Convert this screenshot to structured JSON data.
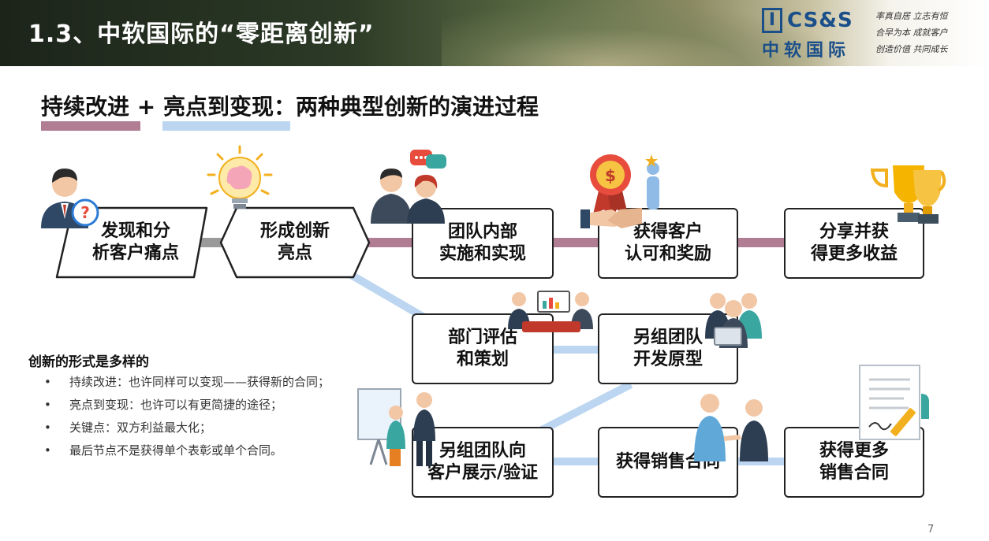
{
  "header": {
    "title": "1.3、中软国际的“零距离创新”"
  },
  "logo": {
    "mark": "I",
    "letters": "CS&S",
    "cn": "中软国际"
  },
  "motto": [
    "率真自居 立志有恒",
    "合早为本 成就客户",
    "创造价值 共同成长"
  ],
  "subtitle": {
    "prefix": "持续改进",
    "plus": "+",
    "highlight": "亮点到变现",
    "rest": "：两种典型创新的演进过程"
  },
  "colors": {
    "mauve": "#b07d93",
    "lightblue": "#bcd6f1",
    "gray": "#9a9a9a",
    "border": "#222222"
  },
  "nodes": {
    "discover": "发现和分\n析客户痛点",
    "form": "形成创新\n亮点",
    "team_impl": "团队内部\n实施和实现",
    "recognition": "获得客户\n认可和奖励",
    "share": "分享并获\n得更多收益",
    "dept_eval": "部门评估\n和策划",
    "proto": "另组团队\n开发原型",
    "demo": "另组团队向\n客户展示/验证",
    "contract": "获得销售合同",
    "more_contracts": "获得更多\n销售合同"
  },
  "forms": {
    "title": "创新的形式是多样的",
    "bullet": "•",
    "items": [
      "持续改进：也许同样可以变现——获得新的合同；",
      "亮点到变现：也许可以有更简捷的途径；",
      "关键点：双方利益最大化；",
      "最后节点不是获得单个表彰或单个合同。"
    ]
  },
  "icons": [
    "person-question-icon",
    "lightbulb-brain-icon",
    "team-discussion-icon",
    "award-medal-icon",
    "handshake-icon",
    "trophy-icon",
    "meeting-icon",
    "team-laptop-icon",
    "presentation-icon",
    "business-handshake-icon",
    "contract-sign-icon"
  ],
  "page_number": "7"
}
